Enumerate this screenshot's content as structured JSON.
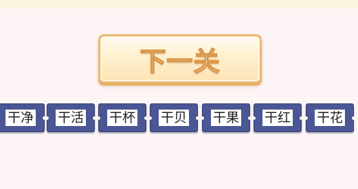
{
  "next_button": {
    "label": "下一关"
  },
  "tiles": [
    {
      "label": "干净"
    },
    {
      "label": "干活"
    },
    {
      "label": "干杯"
    },
    {
      "label": "干贝"
    },
    {
      "label": "干果"
    },
    {
      "label": "干红"
    },
    {
      "label": "干花"
    }
  ],
  "colors": {
    "background": "#fdf5f5",
    "top_strip": "#fcf4dc",
    "tile": "#4b5694",
    "button_border": "#e9b66c",
    "button_text_stroke": "#d9964a"
  }
}
